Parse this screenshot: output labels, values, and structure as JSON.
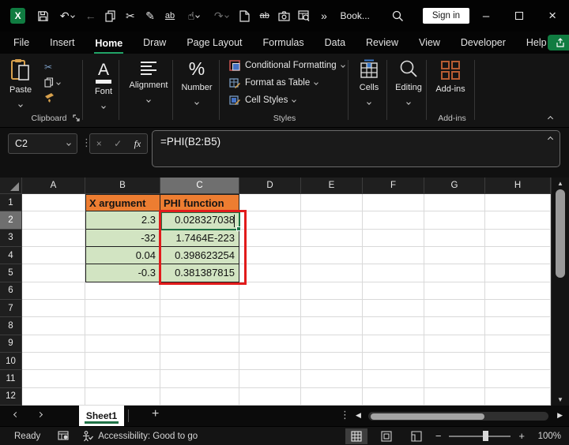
{
  "titlebar": {
    "title": "Book...",
    "sign_in_label": "Sign in"
  },
  "menubar": {
    "items": [
      "File",
      "Insert",
      "Home",
      "Draw",
      "Page Layout",
      "Formulas",
      "Data",
      "Review",
      "View",
      "Developer",
      "Help"
    ],
    "active_item": "Home",
    "share_label": "Share"
  },
  "ribbon": {
    "paste_label": "Paste",
    "font_label": "Font",
    "alignment_label": "Alignment",
    "number_label": "Number",
    "styles_items": [
      "Conditional Formatting",
      "Format as Table",
      "Cell Styles"
    ],
    "cells_label": "Cells",
    "editing_label": "Editing",
    "addins_label": "Add-ins",
    "group_labels": {
      "clipboard": "Clipboard",
      "styles": "Styles",
      "addins": "Add-ins"
    }
  },
  "formula_bar": {
    "name_box": "C2",
    "formula": "=PHI(B2:B5)"
  },
  "grid": {
    "columns": [
      "A",
      "B",
      "C",
      "D",
      "E",
      "F",
      "G",
      "H"
    ],
    "rows": [
      "1",
      "2",
      "3",
      "4",
      "5",
      "6",
      "7",
      "8",
      "9",
      "10",
      "11",
      "12"
    ],
    "selected_column": "C",
    "selected_row": "2",
    "colors": {
      "header_fill": "#ED7D31",
      "data_fill": "#D2E4C2",
      "annotation_box": "#E11B1B",
      "active_cell_border": "#1e7145",
      "brand_green": "#107C41",
      "selected_header": "#6F6F6F"
    }
  },
  "table": {
    "header_x": "X argument",
    "header_phi": "PHI function",
    "rows": [
      {
        "x": "2.3",
        "phi": "0.028327038"
      },
      {
        "x": "-32",
        "phi": "1.7464E-223"
      },
      {
        "x": "0.04",
        "phi": "0.398623254"
      },
      {
        "x": "-0.3",
        "phi": "0.381387815"
      }
    ]
  },
  "sheet_bar": {
    "tabs": [
      "Sheet1"
    ],
    "active_tab": "Sheet1"
  },
  "status_bar": {
    "mode": "Ready",
    "accessibility": "Accessibility: Good to go",
    "zoom_level": "100%"
  },
  "icons": {
    "undo": "↶",
    "redo": "↷",
    "back": "←",
    "cut": "✂",
    "pen": "✎",
    "spelling": "ab",
    "strikethrough": "ab",
    "touch": "☝",
    "overflow": "»",
    "minimize": "–",
    "close": "×",
    "dots_vertical": "⋮",
    "cancel": "×",
    "enter": "✓",
    "fx": "fx",
    "font_glyph": "A",
    "percent": "%",
    "scroll_up": "▲",
    "scroll_down": "▼",
    "scroll_left": "◀",
    "scroll_right": "▶",
    "new_sheet": "+",
    "zoom_out": "−",
    "zoom_in": "+"
  }
}
